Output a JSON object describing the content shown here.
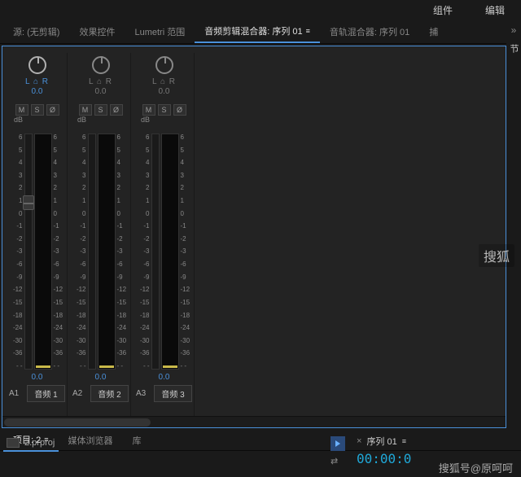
{
  "topbar": {
    "items": [
      "组件",
      "编辑"
    ]
  },
  "tabs": {
    "source": "源: (无剪辑)",
    "effects": "效果控件",
    "lumetri": "Lumetri 范围",
    "clipMixer": "音频剪辑混合器: 序列 01",
    "trackMixer": "音轨混合器: 序列 01",
    "capture": "捕"
  },
  "rightTab": "节",
  "dbTicks": [
    "6",
    "5",
    "4",
    "3",
    "2",
    "1",
    "0",
    "-1",
    "-2",
    "-3",
    "-6",
    "-9",
    "-12",
    "-15",
    "-18",
    "-24",
    "-30",
    "-36",
    "- -"
  ],
  "channels": [
    {
      "id": "A1",
      "name": "音频 1",
      "lr": "L ⌂ R",
      "pan": "0.0",
      "val": "0.0",
      "active": true
    },
    {
      "id": "A2",
      "name": "音频 2",
      "lr": "L ⌂ R",
      "pan": "0.0",
      "val": "0.0",
      "active": false
    },
    {
      "id": "A3",
      "name": "音频 3",
      "lr": "L ⌂ R",
      "pan": "0.0",
      "val": "0.0",
      "active": false
    }
  ],
  "mso": {
    "m": "M",
    "s": "S",
    "o": "Ø"
  },
  "dbLabel": "dB",
  "bottomTabs": {
    "project": "项目: 2",
    "media": "媒体浏览器",
    "lib": "库"
  },
  "projFile": "2.prproj",
  "timeline": {
    "seq": "序列 01",
    "tc": "00:00:0"
  },
  "watermark": "搜狐",
  "attrib": "搜狐号@原呵呵"
}
